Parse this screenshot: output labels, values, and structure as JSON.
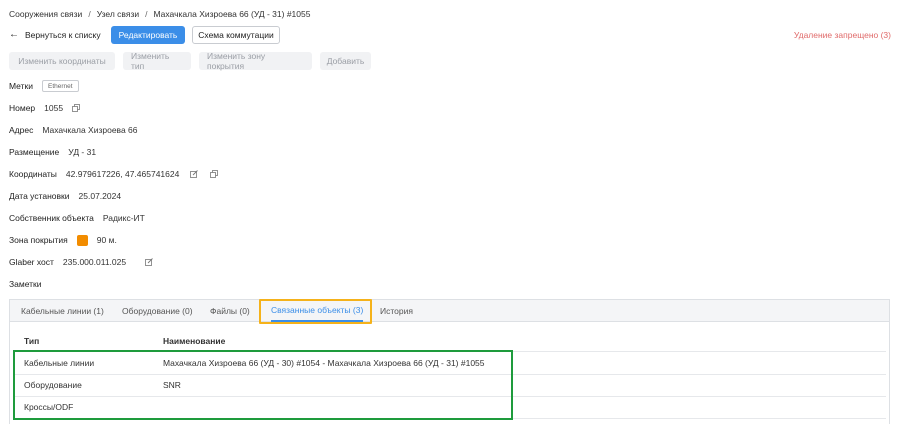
{
  "breadcrumb": {
    "items": [
      "Сооружения связи",
      "Узел связи",
      "Махачкала Хизроева 66 (УД - 31) #1055"
    ],
    "separator": "/"
  },
  "toolbar": {
    "back_label": "Вернуться к списку",
    "edit_label": "Редактировать",
    "scheme_label": "Схема коммутации",
    "delete_note": "Удаление запрещено (3)"
  },
  "actions": {
    "change_coords": "Изменить координаты",
    "change_type": "Изменить тип",
    "change_zone": "Изменить зону покрытия",
    "add": "Добавить"
  },
  "fields": {
    "tags_label": "Метки",
    "tag_value": "Ethernet",
    "number_label": "Номер",
    "number_value": "1055",
    "address_label": "Адрес",
    "address_value": "Махачкала Хизроева 66",
    "placement_label": "Размещение",
    "placement_value": "УД - 31",
    "coords_label": "Координаты",
    "coords_value": "42.979617226, 47.465741624",
    "install_label": "Дата установки",
    "install_value": "25.07.2024",
    "owner_label": "Собственник объекта",
    "owner_value": "Радикс-ИТ",
    "zone_label": "Зона покрытия",
    "zone_value": "90 м.",
    "zone_color": "#f28c00",
    "glaber_label": "Glaber хост",
    "glaber_value": "235.000.011.025",
    "notes_label": "Заметки"
  },
  "tabs": [
    {
      "label": "Кабельные линии (1)"
    },
    {
      "label": "Оборудование (0)"
    },
    {
      "label": "Файлы (0)"
    },
    {
      "label": "Связанные объекты (3)"
    },
    {
      "label": "История"
    }
  ],
  "table": {
    "headers": [
      "Тип",
      "Наименование"
    ],
    "rows": [
      [
        "Кабельные линии",
        "Махачкала Хизроева 66 (УД - 30) #1054 - Махачкала Хизроева 66 (УД - 31) #1055"
      ],
      [
        "Оборудование",
        "SNR"
      ],
      [
        "Кроссы/ODF",
        ""
      ]
    ]
  },
  "colors": {
    "accent": "#3b8ee8",
    "danger": "#e06a6a",
    "highlight_tab": "#f5b21a",
    "highlight_table": "#1e9b3c"
  }
}
